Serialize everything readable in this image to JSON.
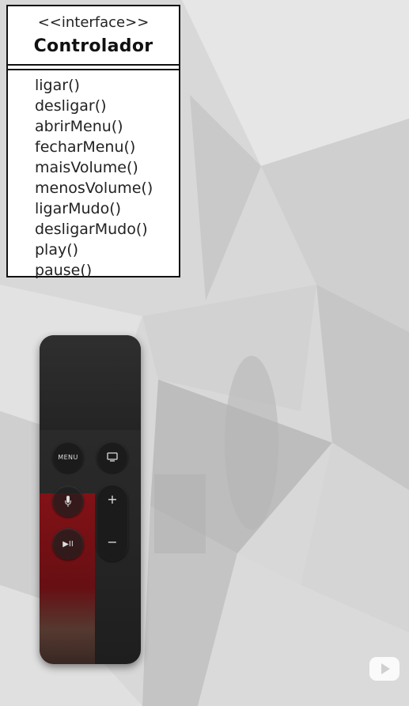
{
  "uml": {
    "stereotype": "<<interface>>",
    "class_name": "Controlador",
    "operations": [
      "ligar()",
      "desligar()",
      "abrirMenu()",
      "fecharMenu()",
      "maisVolume()",
      "menosVolume()",
      "ligarMudo()",
      "desligarMudo()",
      "play()",
      "pause()"
    ]
  },
  "remote": {
    "menu_label": "MENU",
    "plus_label": "+",
    "minus_label": "−",
    "play_pause_label": "▶II",
    "icons": [
      "tv-icon",
      "microphone-icon"
    ]
  },
  "colors": {
    "background": "#d9d9d9",
    "remote_body": "#2a2a2a",
    "box_border": "#111111"
  }
}
